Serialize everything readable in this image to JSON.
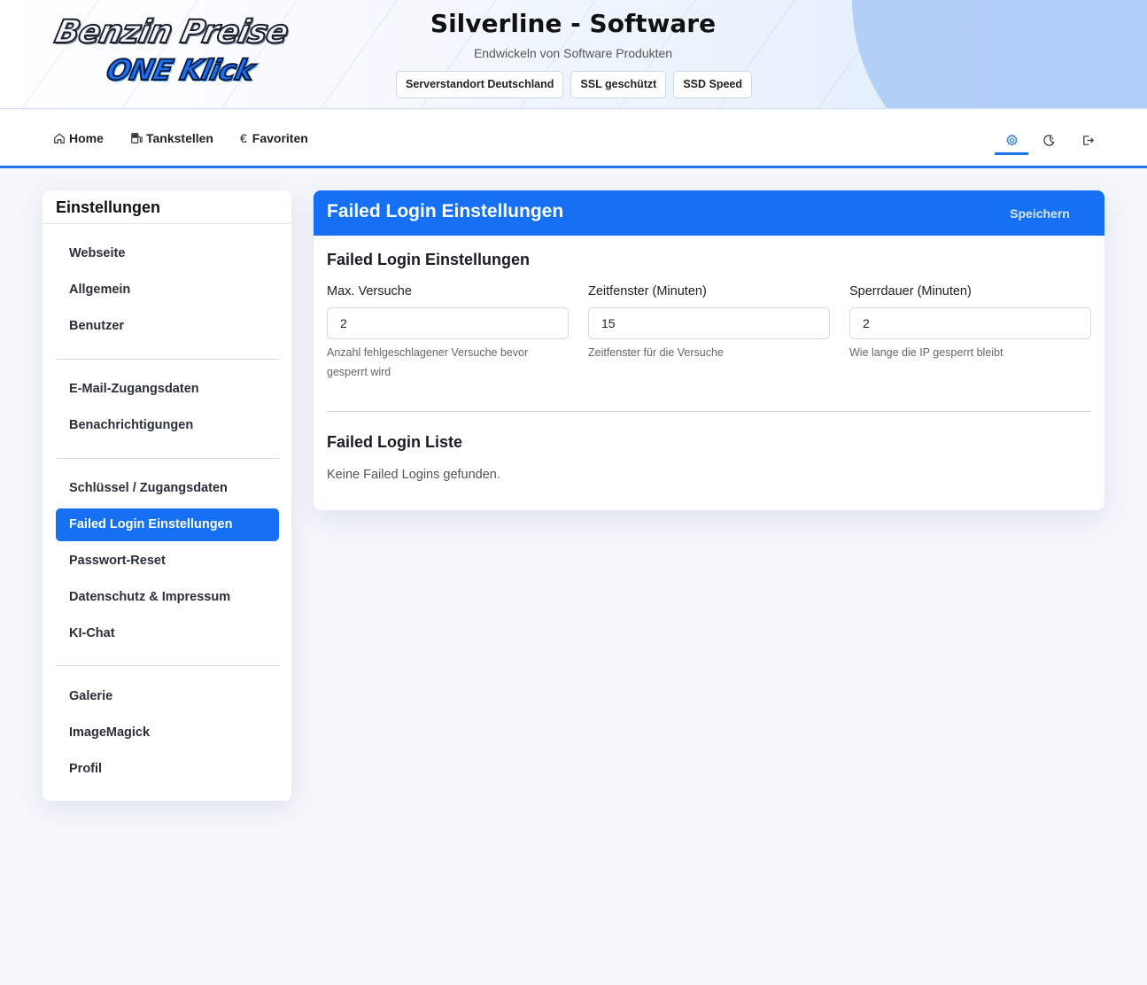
{
  "header": {
    "logo_line1": "Benzin Preise",
    "logo_line2": "ONE Klick",
    "title": "Silverline - Software",
    "subtitle": "Endwickeln von Software Produkten",
    "badges": [
      "Serverstandort Deutschland",
      "SSL geschützt",
      "SSD Speed"
    ]
  },
  "nav": {
    "items": [
      {
        "label": "Home",
        "icon": "home-icon"
      },
      {
        "label": "Tankstellen",
        "icon": "fuel-pump-icon"
      },
      {
        "label": "Favoriten",
        "icon": "euro-icon"
      }
    ],
    "right_icons": [
      "gear-icon",
      "moon-icon",
      "logout-icon"
    ],
    "active_right_icon": "gear-icon"
  },
  "sidebar": {
    "title": "Einstellungen",
    "groups": [
      [
        "Webseite",
        "Allgemein",
        "Benutzer"
      ],
      [
        "E-Mail-Zugangsdaten",
        "Benachrichtigungen"
      ],
      [
        "Schlüssel / Zugangsdaten",
        "Failed Login Einstellungen",
        "Passwort-Reset",
        "Datenschutz & Impressum",
        "KI-Chat"
      ],
      [
        "Galerie",
        "ImageMagick",
        "Profil"
      ]
    ],
    "active_item": "Failed Login Einstellungen"
  },
  "main": {
    "header_title": "Failed Login Einstellungen",
    "save_label": "Speichern",
    "settings_title": "Failed Login Einstellungen",
    "fields": [
      {
        "label": "Max. Versuche",
        "value": "2",
        "help": "Anzahl fehlgeschlagener Versuche bevor gesperrt wird"
      },
      {
        "label": "Zeitfenster (Minuten)",
        "value": "15",
        "help": "Zeitfenster für die Versuche"
      },
      {
        "label": "Sperrdauer (Minuten)",
        "value": "2",
        "help": "Wie lange die IP gesperrt bleibt"
      }
    ],
    "list_title": "Failed Login Liste",
    "empty_text": "Keine Failed Logins gefunden."
  },
  "colors": {
    "accent": "#1570f4",
    "nav_underline": "#1f73e8",
    "background": "#f4f6fb"
  }
}
